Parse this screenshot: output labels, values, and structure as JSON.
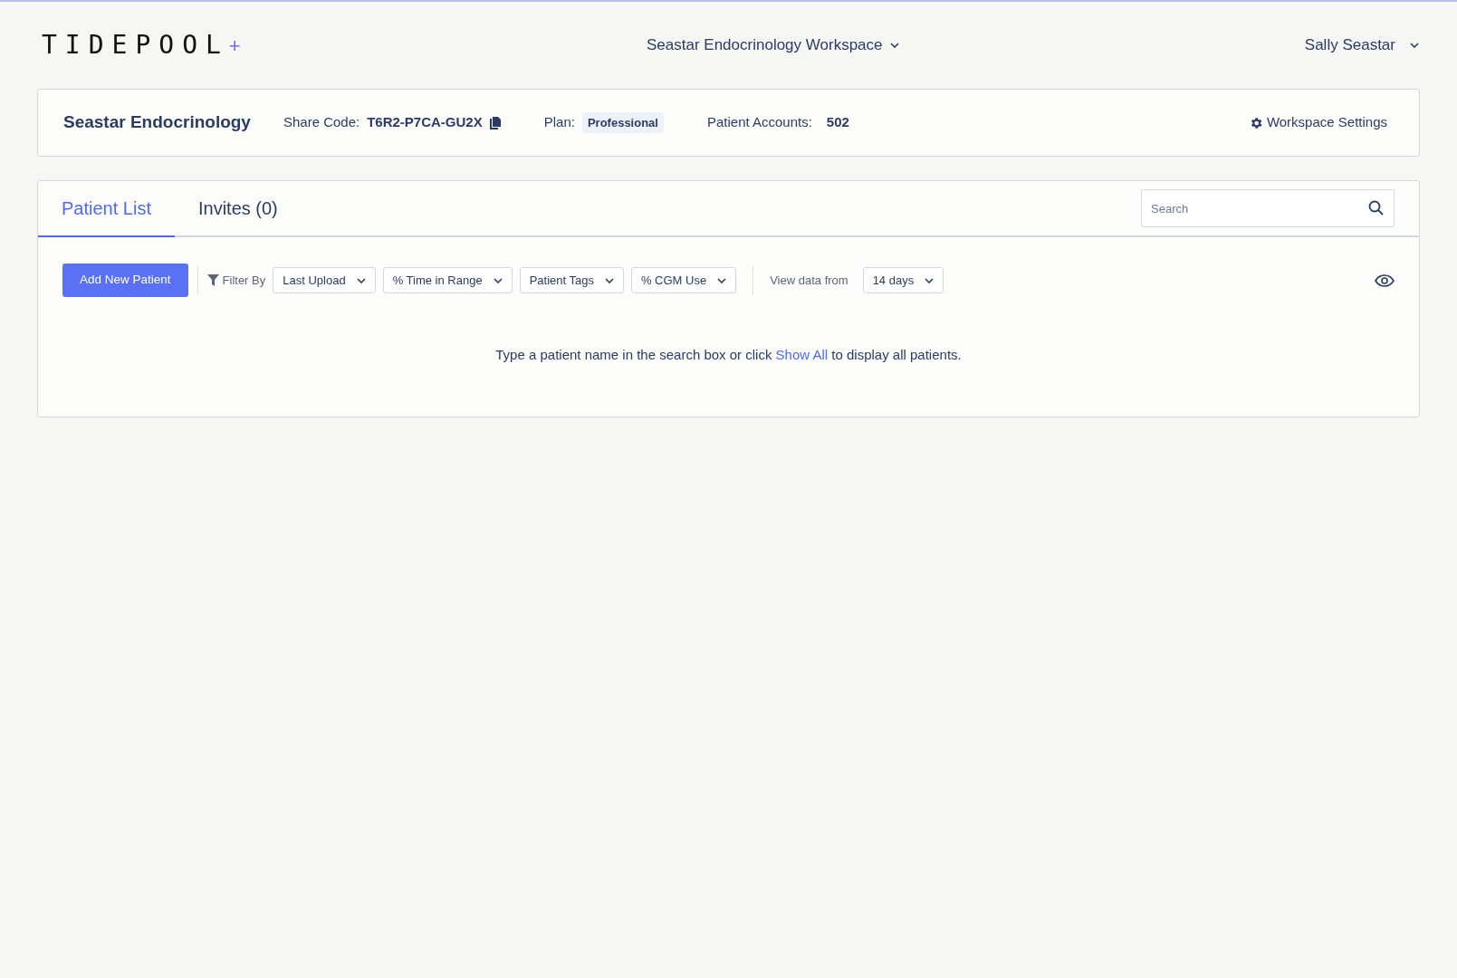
{
  "header": {
    "logo": "TIDEPOOL",
    "logo_plus": "+",
    "workspace_menu": "Seastar Endocrinology Workspace",
    "user_menu": "Sally Seastar"
  },
  "workspace": {
    "name": "Seastar Endocrinology",
    "share_code_label": "Share Code:",
    "share_code": "T6R2-P7CA-GU2X",
    "plan_label": "Plan:",
    "plan": "Professional",
    "accounts_label": "Patient Accounts:",
    "accounts": "502",
    "settings": "Workspace Settings"
  },
  "tabs": [
    {
      "label": "Patient List",
      "selected": true
    },
    {
      "label": "Invites (0)",
      "selected": false
    }
  ],
  "search": {
    "placeholder": "Search"
  },
  "toolbar": {
    "add_button": "Add New Patient",
    "filter_label": "Filter By",
    "filters": [
      "Last Upload",
      "% Time in Range",
      "Patient Tags",
      "% CGM Use"
    ],
    "view_label": "View data from",
    "view_range": "14 days"
  },
  "message": "Type a patient name in the search box or click ",
  "message_link": "Show All",
  "message_end": " to display all patients."
}
